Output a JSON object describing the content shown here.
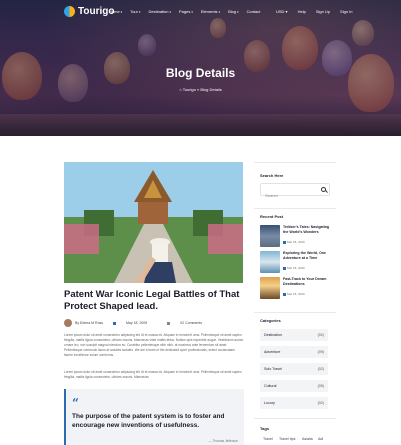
{
  "brand": {
    "name": "Tourigo"
  },
  "nav": {
    "items": [
      {
        "label": "Home",
        "caret": "▾"
      },
      {
        "label": "Tour",
        "caret": "▾"
      },
      {
        "label": "Destination",
        "caret": "▾"
      },
      {
        "label": "Pages",
        "caret": "▾"
      },
      {
        "label": "Elements",
        "caret": "▾"
      },
      {
        "label": "Blog",
        "caret": "▾"
      },
      {
        "label": "Contact",
        "caret": ""
      }
    ],
    "currency": "USD ▾",
    "help": "Help",
    "signup": "Sign Up",
    "signin": "Sign In"
  },
  "hero": {
    "title": "Blog Details",
    "breadcrumb_home": "Tourigo",
    "breadcrumb_sep": "»",
    "breadcrumb_current": "Blog Details"
  },
  "post": {
    "title": "Patent War Iconic Legal Battles of That Protect Shaped lead.",
    "author": "By Edena M Ross",
    "date": "May 18, 2009",
    "comments": "02 Comments",
    "para1": "Lorem ipsum dolor sit amet consectetur adipiscing elit Ut et massa mi. Aliquam in hendrerit urna. Pellentesque sit amet sapien fringilla, mattis ligula consectetur, ultrices mauris. Maecenas vitae mattis tellus. Nullam quis imperdiet augue. Vestibulum auctor ornare leo, non suscipit magna interdum eu. Curabitur pellentesque nibh nibh, at maximus ante fermentum sit amet. Pellentesque commodo lacus at sodales sodales. We are a team of the dedicated sport professionals, select occaecatam facere excellence solum comforms.",
    "para2": "Lorem ipsum dolor sit amet consectetur adipiscing elit Ut et massa mi. Aliquam in hendrerit urna. Pellentesque sit amet sapien fringilla, mattis ligula consectetur, ultrices mauris. Maecenas",
    "quote_mark": "“",
    "quote": "The purpose of the patent system is to foster and encourage new inventions of usefulness.",
    "quote_author": "— Thomas Jefferson"
  },
  "sidebar": {
    "search_title": "Search Here",
    "search_placeholder": "Search",
    "recent_title": "Recent Post",
    "recent": [
      {
        "title": "Trekker's Tales: Navigating the World's Wonders",
        "date": "Mar 18, 2009"
      },
      {
        "title": "Exploring the World, One Adventure at a Time",
        "date": "Mar 18, 2009"
      },
      {
        "title": "Fast-Track to Your Dream Destinations",
        "date": "Mar 18, 2009"
      }
    ],
    "categories_title": "Categories",
    "categories": [
      {
        "label": "Destination",
        "count": "(02)"
      },
      {
        "label": "Adventure",
        "count": "(09)"
      },
      {
        "label": "Solo Travel",
        "count": "(02)"
      },
      {
        "label": "Cultural",
        "count": "(05)"
      },
      {
        "label": "Luxury",
        "count": "(02)"
      }
    ],
    "tags_title": "Tags",
    "tags": [
      "Travel",
      "Travel tips",
      "Asialia",
      "Adi"
    ]
  },
  "colors": {
    "accent": "#2b6cb0",
    "brand_yellow": "#f5b21b",
    "brand_blue": "#2fa4e7"
  }
}
